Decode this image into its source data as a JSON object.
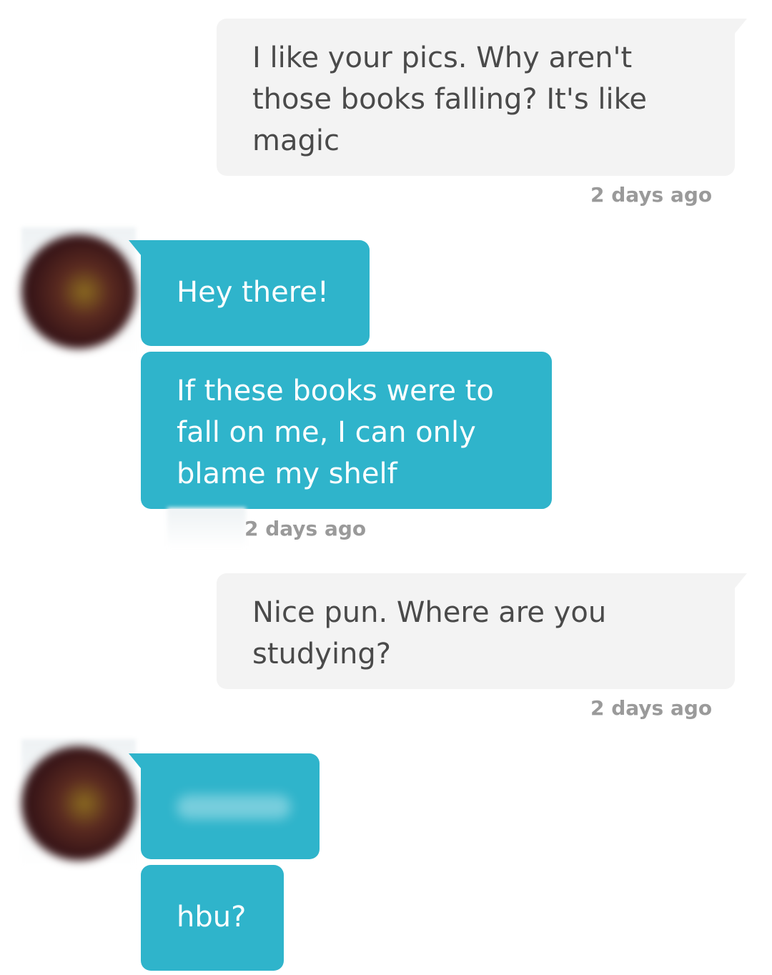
{
  "conversation": {
    "messages": [
      {
        "from": "me",
        "text": "I like your pics. Why aren't those books falling? It's like magic",
        "timestamp": "2 days ago"
      },
      {
        "from": "them",
        "text": "Hey there!"
      },
      {
        "from": "them",
        "text": "If these books were to fall on me, I can only blame my shelf",
        "timestamp": "2 days ago"
      },
      {
        "from": "me",
        "text": "Nice pun. Where are you studying?",
        "timestamp": "2 days ago"
      },
      {
        "from": "them",
        "text": ""
      },
      {
        "from": "them",
        "text": "hbu?"
      }
    ]
  },
  "colors": {
    "sent_bubble": "#f3f3f3",
    "sent_text": "#4a4a4a",
    "received_bubble": "#2fb4cb",
    "received_text": "#ffffff",
    "timestamp": "#9a9a9a"
  }
}
